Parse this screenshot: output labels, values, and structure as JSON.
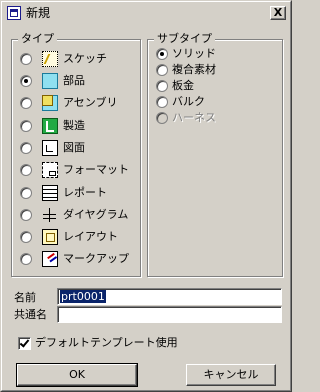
{
  "window": {
    "title": "新規",
    "close_label": "X"
  },
  "type_group": {
    "label": "タイプ",
    "items": [
      {
        "label": "スケッチ",
        "icon": "sketch-icon",
        "selected": false
      },
      {
        "label": "部品",
        "icon": "part-icon",
        "selected": true
      },
      {
        "label": "アセンブリ",
        "icon": "assembly-icon",
        "selected": false
      },
      {
        "label": "製造",
        "icon": "manufacturing-icon",
        "selected": false
      },
      {
        "label": "図面",
        "icon": "drawing-icon",
        "selected": false
      },
      {
        "label": "フォーマット",
        "icon": "format-icon",
        "selected": false
      },
      {
        "label": "レポート",
        "icon": "report-icon",
        "selected": false
      },
      {
        "label": "ダイヤグラム",
        "icon": "diagram-icon",
        "selected": false
      },
      {
        "label": "レイアウト",
        "icon": "layout-icon",
        "selected": false
      },
      {
        "label": "マークアップ",
        "icon": "markup-icon",
        "selected": false
      }
    ]
  },
  "subtype_group": {
    "label": "サブタイプ",
    "items": [
      {
        "label": "ソリッド",
        "selected": true,
        "enabled": true
      },
      {
        "label": "複合素材",
        "selected": false,
        "enabled": true
      },
      {
        "label": "板金",
        "selected": false,
        "enabled": true
      },
      {
        "label": "バルク",
        "selected": false,
        "enabled": true
      },
      {
        "label": "ハーネス",
        "selected": false,
        "enabled": false
      }
    ]
  },
  "fields": {
    "name_label": "名前",
    "name_value": "prt0001",
    "common_name_label": "共通名",
    "common_name_value": ""
  },
  "default_template": {
    "label": "デフォルトテンプレート使用",
    "checked": true
  },
  "buttons": {
    "ok": "OK",
    "cancel": "キャンセル"
  },
  "colors": {
    "face": "#d4d0c8",
    "selection": "#0a246a",
    "disabled_text": "#808080"
  }
}
